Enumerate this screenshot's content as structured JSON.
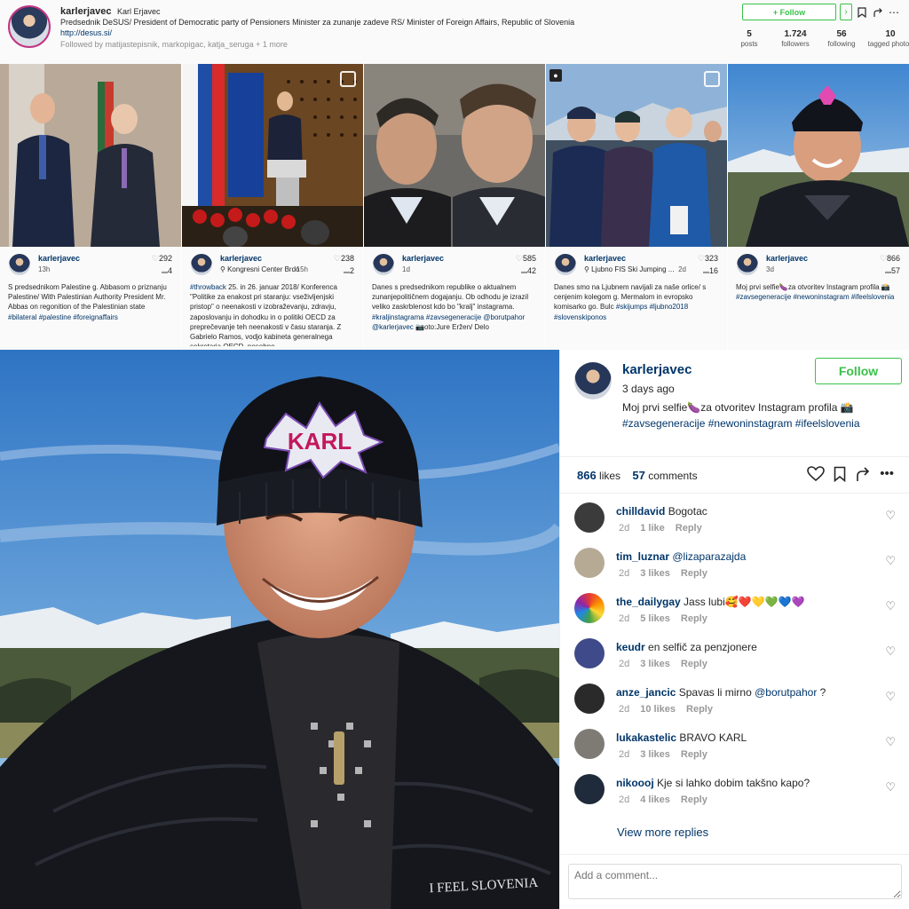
{
  "profile": {
    "username": "karlerjavec",
    "full_name": "Karl Erjavec",
    "bio": "Predsednik DeSUS/ President of Democratic party of Pensioners Minister za zunanje zadeve RS/ Minister of Foreign Affairs, Republic of Slovenia",
    "link": "http://desus.si/",
    "followed_by": "Followed by matijastepisnik, markopigac, katja_seruga + 1 more",
    "follow_label": "+ Follow",
    "dropdown_glyph": "›",
    "stats": [
      {
        "value": "5",
        "label": "posts"
      },
      {
        "value": "1.724",
        "label": "followers"
      },
      {
        "value": "56",
        "label": "following"
      },
      {
        "value": "10",
        "label": "tagged photos"
      }
    ]
  },
  "grid": [
    {
      "user": "karlerjavec",
      "location": "",
      "time": "13h",
      "likes": "292",
      "comments": "4",
      "caption": "S predsednikom Palestine g. Abbasom o priznanju Palestine/ With Palestinian Authority President Mr. Abbas on regonition of the Palestinian state ",
      "tags": "#bilateral #palestine #foreignaffairs"
    },
    {
      "user": "karlerjavec",
      "location": "Kongresni Center Brdo",
      "time": "15h",
      "likes": "238",
      "comments": "2",
      "caption_tag": "#throwback",
      "caption": " 25. in 26. januar 2018/ Konferenca \"Politike za enakost pri staranju: vseživljenjski pristop\" o neenakosti v izobraževanju, zdravju, zaposlovanju in dohodku in o politiki OECD za preprečevanje teh neenakosti v času staranja. Z Gabrielo Ramos, vodjo kabineta generalnega sekretarja OECD, posebno",
      "tags": ""
    },
    {
      "user": "karlerjavec",
      "location": "",
      "time": "1d",
      "likes": "585",
      "comments": "42",
      "caption": "Danes s predsednikom republike o aktualnem zunanjepolitičnem dogajanju. Ob odhodu je izrazil veliko zaskrblenost kdo bo \"kralj\" instagrama. ",
      "tags": "#kraljinstagrama #zavsegeneracije @borutpahor @karlerjavec",
      "caption_tail": " 📷oto:Jure Eržen/ Delo"
    },
    {
      "user": "karlerjavec",
      "location": "Ljubno FIS Ski Jumping ...",
      "time": "2d",
      "likes": "323",
      "comments": "16",
      "caption": "Danes smo na Ljubnem navijali za naše orlice/ s cenjenim kolegom g. Mermalom in evropsko komisarko go. Bulc ",
      "tags": "#skijumps #ljubno2018 #slovenskiponos"
    },
    {
      "user": "karlerjavec",
      "location": "",
      "time": "3d",
      "likes": "866",
      "comments": "57",
      "caption": "Moj prvi selfie🍆za otvoritev Instagram profila 📸",
      "tags": "#zavsegeneracije #newoninstagram #ifeelslovenia"
    }
  ],
  "post": {
    "username": "karlerjavec",
    "time": "3 days ago",
    "follow_label": "Follow",
    "caption": "Moj prvi selfie🍆za otvoritev Instagram profila 📸",
    "tags": "#zavsegeneracije #newoninstagram #ifeelslovenia",
    "likes_count": "866",
    "likes_label": "likes",
    "comments_count": "57",
    "comments_label": "comments",
    "photo_texts": {
      "hat": "KARL",
      "jacket": "I FEEL SLOVENIA"
    },
    "comments": [
      {
        "user": "chilldavid",
        "text": "Bogotac",
        "mention": "",
        "time": "2d",
        "likes": "1 like",
        "reply": "Reply"
      },
      {
        "user": "tim_luznar",
        "text": "",
        "mention": "@lizaparazajda",
        "time": "2d",
        "likes": "3 likes",
        "reply": "Reply"
      },
      {
        "user": "the_dailygay",
        "text": "Jass lubi🥰❤️💛💚💙💜",
        "mention": "",
        "time": "2d",
        "likes": "5 likes",
        "reply": "Reply"
      },
      {
        "user": "keudr",
        "text": "en selfič za penzjonere",
        "mention": "",
        "time": "2d",
        "likes": "3 likes",
        "reply": "Reply"
      },
      {
        "user": "anze_jancic",
        "text": "Spavas li mirno ",
        "mention": "@borutpahor",
        "text_after": " ?",
        "time": "2d",
        "likes": "10 likes",
        "reply": "Reply"
      },
      {
        "user": "lukakastelic",
        "text": "BRAVO KARL",
        "mention": "",
        "time": "2d",
        "likes": "3 likes",
        "reply": "Reply"
      },
      {
        "user": "nikoooj",
        "text": "Kje si lahko dobim takšno kapo?",
        "mention": "",
        "time": "2d",
        "likes": "4 likes",
        "reply": "Reply"
      }
    ],
    "view_more": "View more replies",
    "add_comment_placeholder": "Add a comment..."
  },
  "colors": {
    "accent_green": "#3ac24a",
    "link_blue": "#003569",
    "text": "#262626"
  },
  "icons": [
    "heart-icon",
    "bookmark-icon",
    "share-icon",
    "more-icon",
    "comment-icon",
    "location-pin-icon",
    "tagged-user-icon",
    "multiple-photos-icon"
  ]
}
